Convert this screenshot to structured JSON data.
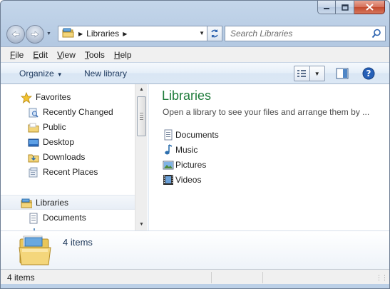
{
  "window": {
    "caption_buttons": {
      "minimize_icon": "minimize-icon",
      "maximize_icon": "maximize-icon",
      "close_icon": "close-icon"
    }
  },
  "nav": {
    "address_segments": [
      "Libraries"
    ],
    "search_placeholder": "Search Libraries"
  },
  "menubar": {
    "items": [
      "File",
      "Edit",
      "View",
      "Tools",
      "Help"
    ]
  },
  "toolbar": {
    "organize_label": "Organize",
    "new_library_label": "New library"
  },
  "navigation_pane": {
    "favorites_label": "Favorites",
    "favorites": [
      "Recently Changed",
      "Public",
      "Desktop",
      "Downloads",
      "Recent Places"
    ],
    "libraries_label": "Libraries",
    "libraries": [
      "Documents"
    ]
  },
  "main": {
    "title": "Libraries",
    "subtitle": "Open a library to see your files and arrange them by ...",
    "libraries": [
      "Documents",
      "Music",
      "Pictures",
      "Videos"
    ]
  },
  "details": {
    "item_count": "4 items"
  },
  "statusbar": {
    "text": "4 items"
  },
  "colors": {
    "title_green": "#1e7b3a",
    "accent_blue": "#1e395b",
    "close_red": "#c34a2e"
  }
}
